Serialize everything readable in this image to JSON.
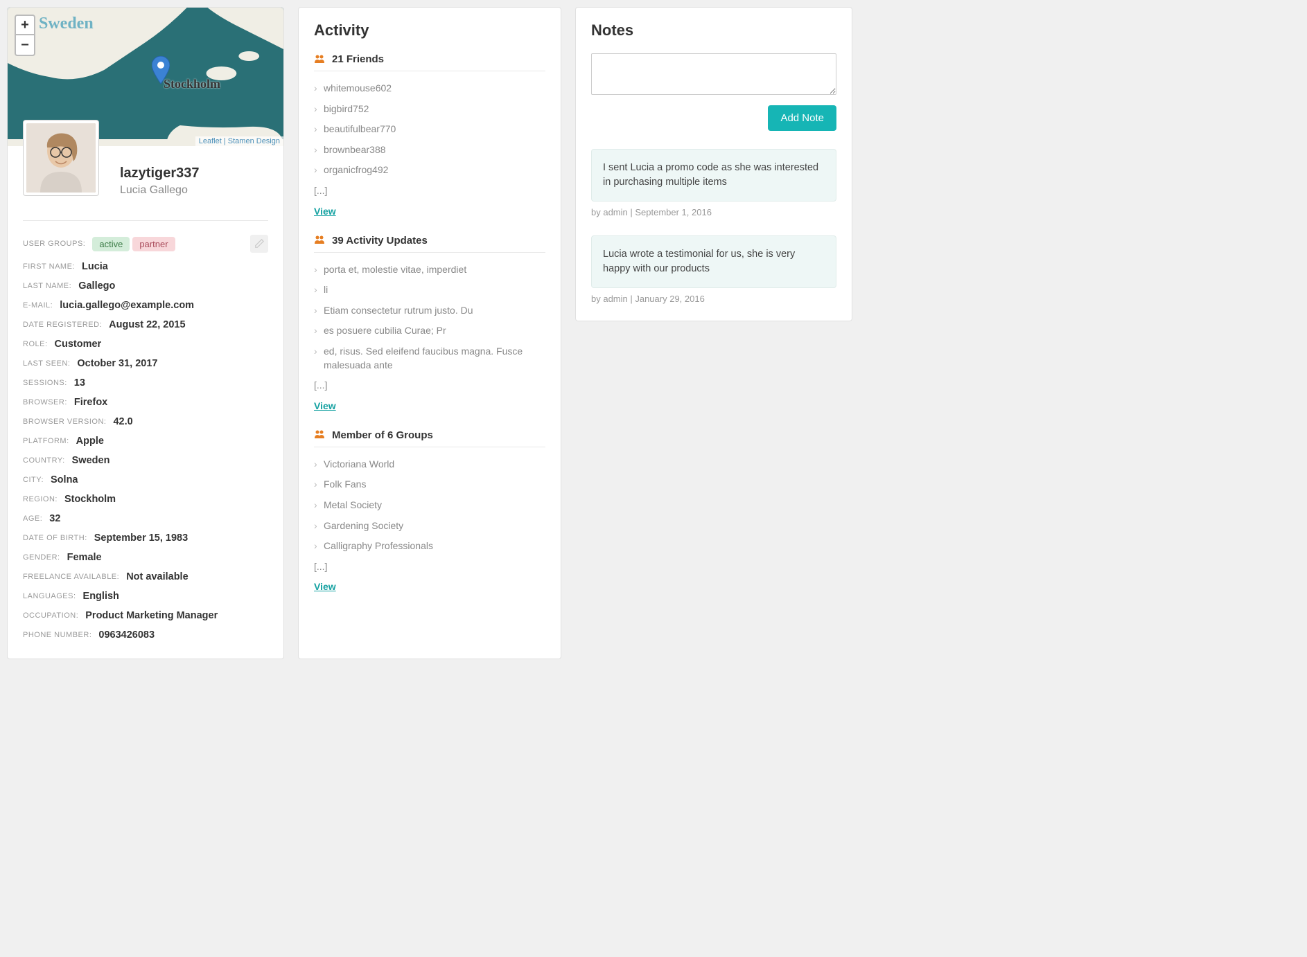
{
  "profile": {
    "username": "lazytiger337",
    "fullname": "Lucia Gallego",
    "map": {
      "country_label": "Sweden",
      "city_label": "Stockholm",
      "zoom_in": "+",
      "zoom_out": "−",
      "attribution_leaflet": "Leaflet",
      "attribution_sep": " | ",
      "attribution_stamen": "Stamen Design"
    },
    "badges": {
      "active": "active",
      "partner": "partner"
    },
    "fields": {
      "user_groups_label": "USER GROUPS:",
      "first_name_label": "FIRST NAME:",
      "first_name": "Lucia",
      "last_name_label": "LAST NAME:",
      "last_name": "Gallego",
      "email_label": "E-MAIL:",
      "email": "lucia.gallego@example.com",
      "date_registered_label": "DATE REGISTERED:",
      "date_registered": "August 22, 2015",
      "role_label": "ROLE:",
      "role": "Customer",
      "last_seen_label": "LAST SEEN:",
      "last_seen": "October 31, 2017",
      "sessions_label": "SESSIONS:",
      "sessions": "13",
      "browser_label": "BROWSER:",
      "browser": "Firefox",
      "browser_version_label": "BROWSER VERSION:",
      "browser_version": "42.0",
      "platform_label": "PLATFORM:",
      "platform": "Apple",
      "country_label": "COUNTRY:",
      "country": "Sweden",
      "city_label": "CITY:",
      "city": "Solna",
      "region_label": "REGION:",
      "region": "Stockholm",
      "age_label": "AGE:",
      "age": "32",
      "dob_label": "DATE OF BIRTH:",
      "dob": "September 15, 1983",
      "gender_label": "GENDER:",
      "gender": "Female",
      "freelance_label": "FREELANCE AVAILABLE:",
      "freelance": "Not available",
      "languages_label": "LANGUAGES:",
      "languages": "English",
      "occupation_label": "OCCUPATION:",
      "occupation": "Product Marketing Manager",
      "phone_label": "PHONE NUMBER:",
      "phone": "0963426083"
    }
  },
  "activity": {
    "title": "Activity",
    "view_label": "View",
    "ellipsis": "[...]",
    "friends": {
      "title": "21 Friends",
      "items": [
        "whitemouse602",
        "bigbird752",
        "beautifulbear770",
        "brownbear388",
        "organicfrog492"
      ]
    },
    "updates": {
      "title": "39 Activity Updates",
      "items": [
        "porta et, molestie vitae, imperdiet",
        "li",
        "Etiam consectetur rutrum justo. Du",
        "es posuere cubilia Curae; Pr",
        "ed, risus. Sed eleifend faucibus magna. Fusce malesuada ante"
      ]
    },
    "groups": {
      "title": "Member of 6 Groups",
      "items": [
        "Victoriana World",
        "Folk Fans",
        "Metal Society",
        "Gardening Society",
        "Calligraphy Professionals"
      ]
    }
  },
  "notes": {
    "title": "Notes",
    "add_button": "Add Note",
    "items": [
      {
        "text": "I sent Lucia a promo code as she was interested in purchasing multiple items",
        "meta": "by admin | September 1, 2016"
      },
      {
        "text": "Lucia wrote a testimonial for us, she is very happy with our products",
        "meta": "by admin | January 29, 2016"
      }
    ]
  }
}
